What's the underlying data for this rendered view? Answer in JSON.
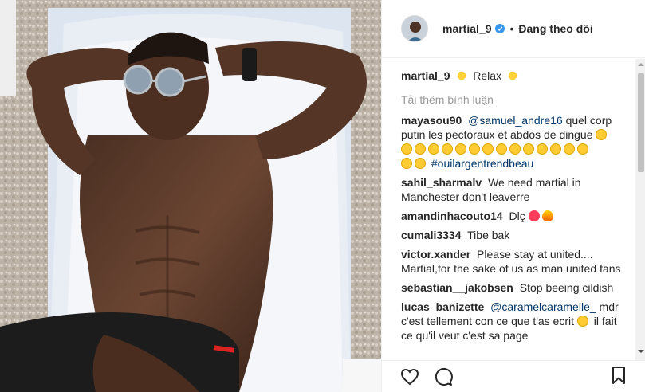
{
  "header": {
    "username": "martial_9",
    "dot": "•",
    "follow_label": "Đang theo dõi"
  },
  "caption": {
    "username": "martial_9",
    "text": "Relax"
  },
  "load_more_label": "Tải thêm bình luận",
  "comments": [
    {
      "user": "mayasou90",
      "mention": "@samuel_andre16",
      "text": "quel corp putin les pectoraux et abdos de dingue",
      "tail": "#ouilargentrendbeau"
    },
    {
      "user": "sahil_sharmalv",
      "text": "We need martial in Manchester don't leaverre"
    },
    {
      "user": "amandinhacouto14",
      "text": "Dlç"
    },
    {
      "user": "cumali3334",
      "text": "Tibe bak"
    },
    {
      "user": "victor.xander",
      "text": "Please stay at united.... Martial,for the sake of us as man united fans"
    },
    {
      "user": "sebastian__jakobsen",
      "text": "Stop beeing cildish"
    },
    {
      "user": "lucas_banizette",
      "mention": "@caramelcaramelle_",
      "text": "mdr c'est tellement con ce que t'as ecrit",
      "text2": "il fait ce qu'il veut c'est sa page"
    }
  ],
  "icons": {
    "verified": "verified-badge-icon",
    "like": "heart-icon",
    "comment": "comment-bubble-icon",
    "save": "bookmark-icon"
  },
  "colors": {
    "verified": "#3897f0",
    "text": "#262626",
    "muted": "#999999",
    "mention": "#003569"
  }
}
